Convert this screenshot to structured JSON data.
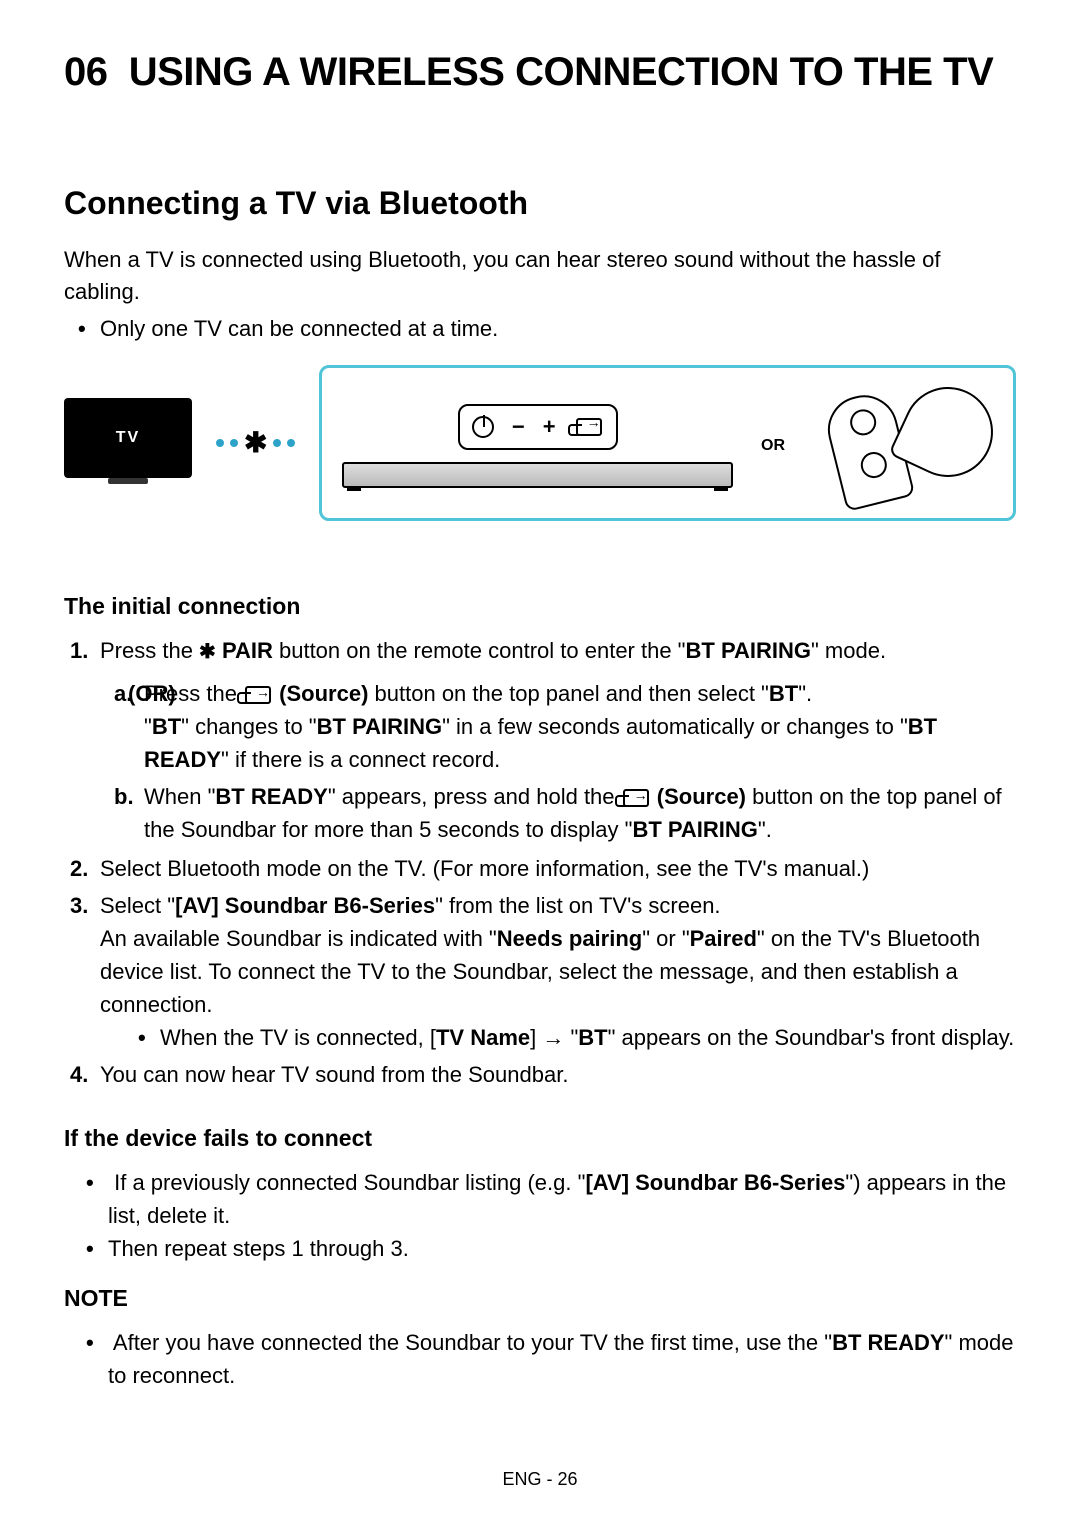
{
  "header": {
    "chapter_num": "06",
    "chapter_title": "USING A WIRELESS CONNECTION TO THE TV"
  },
  "section": {
    "title": "Connecting a TV via Bluetooth",
    "intro": "When a TV is connected using Bluetooth, you can hear stereo sound without the hassle of cabling.",
    "intro_bullet": "Only one TV can be connected at a time."
  },
  "diagram": {
    "tv_label": "TV",
    "or_label": "OR",
    "panel_minus": "−",
    "panel_plus": "+"
  },
  "initial": {
    "heading": "The initial connection",
    "or_label": "(OR)",
    "step1": {
      "num": "1.",
      "pre": "Press the ",
      "pair": "PAIR",
      "post1": " button on the remote control to enter the \"",
      "bt_pairing": "BT PAIRING",
      "post2": "\" mode."
    },
    "step1a": {
      "letter": "a.",
      "pre": "Press the ",
      "source": "(Source)",
      "mid": " button on the top panel and then select \"",
      "bt": "BT",
      "mid2": "\".",
      "line2_pre": "\"",
      "line2_bt": "BT",
      "line2_mid1": "\" changes to \"",
      "line2_btpair": "BT PAIRING",
      "line2_mid2": "\" in a few seconds automatically or changes to \"",
      "line2_btready": "BT READY",
      "line2_end": "\" if there is a connect record."
    },
    "step1b": {
      "letter": "b.",
      "pre": "When \"",
      "btready": "BT READY",
      "mid": "\" appears, press and hold the ",
      "source": "(Source)",
      "post": " button on the top panel of the Soundbar for more than 5 seconds to display \"",
      "btpair": "BT PAIRING",
      "end": "\"."
    },
    "step2": {
      "num": "2.",
      "text": "Select Bluetooth mode on the TV. (For more information, see the TV's manual.)"
    },
    "step3": {
      "num": "3.",
      "pre": "Select \"",
      "device": "[AV] Soundbar B6-Series",
      "post": "\" from the list on TV's screen.",
      "line2_pre": "An available Soundbar is indicated with \"",
      "needs": "Needs pairing",
      "line2_mid": "\" or \"",
      "paired": "Paired",
      "line2_end": "\" on the TV's Bluetooth device list. To connect the TV to the Soundbar, select the message, and then establish a connection.",
      "bullet_pre": "When the TV is connected, [",
      "tvname": "TV Name",
      "bullet_mid": "] → \"",
      "bt": "BT",
      "bullet_end": "\" appears on the Soundbar's front display."
    },
    "step4": {
      "num": "4.",
      "text": "You can now hear TV sound from the Soundbar."
    }
  },
  "fails": {
    "heading": "If the device fails to connect",
    "b1_pre": "If a previously connected Soundbar listing (e.g. \"",
    "b1_dev": "[AV] Soundbar B6-Series",
    "b1_post": "\") appears in the list, delete it.",
    "b2": "Then repeat steps 1 through 3."
  },
  "note": {
    "heading": "NOTE",
    "pre": "After you have connected the Soundbar to your TV the first time, use the \"",
    "btready": "BT READY",
    "post": "\" mode to reconnect."
  },
  "footer": "ENG - 26"
}
